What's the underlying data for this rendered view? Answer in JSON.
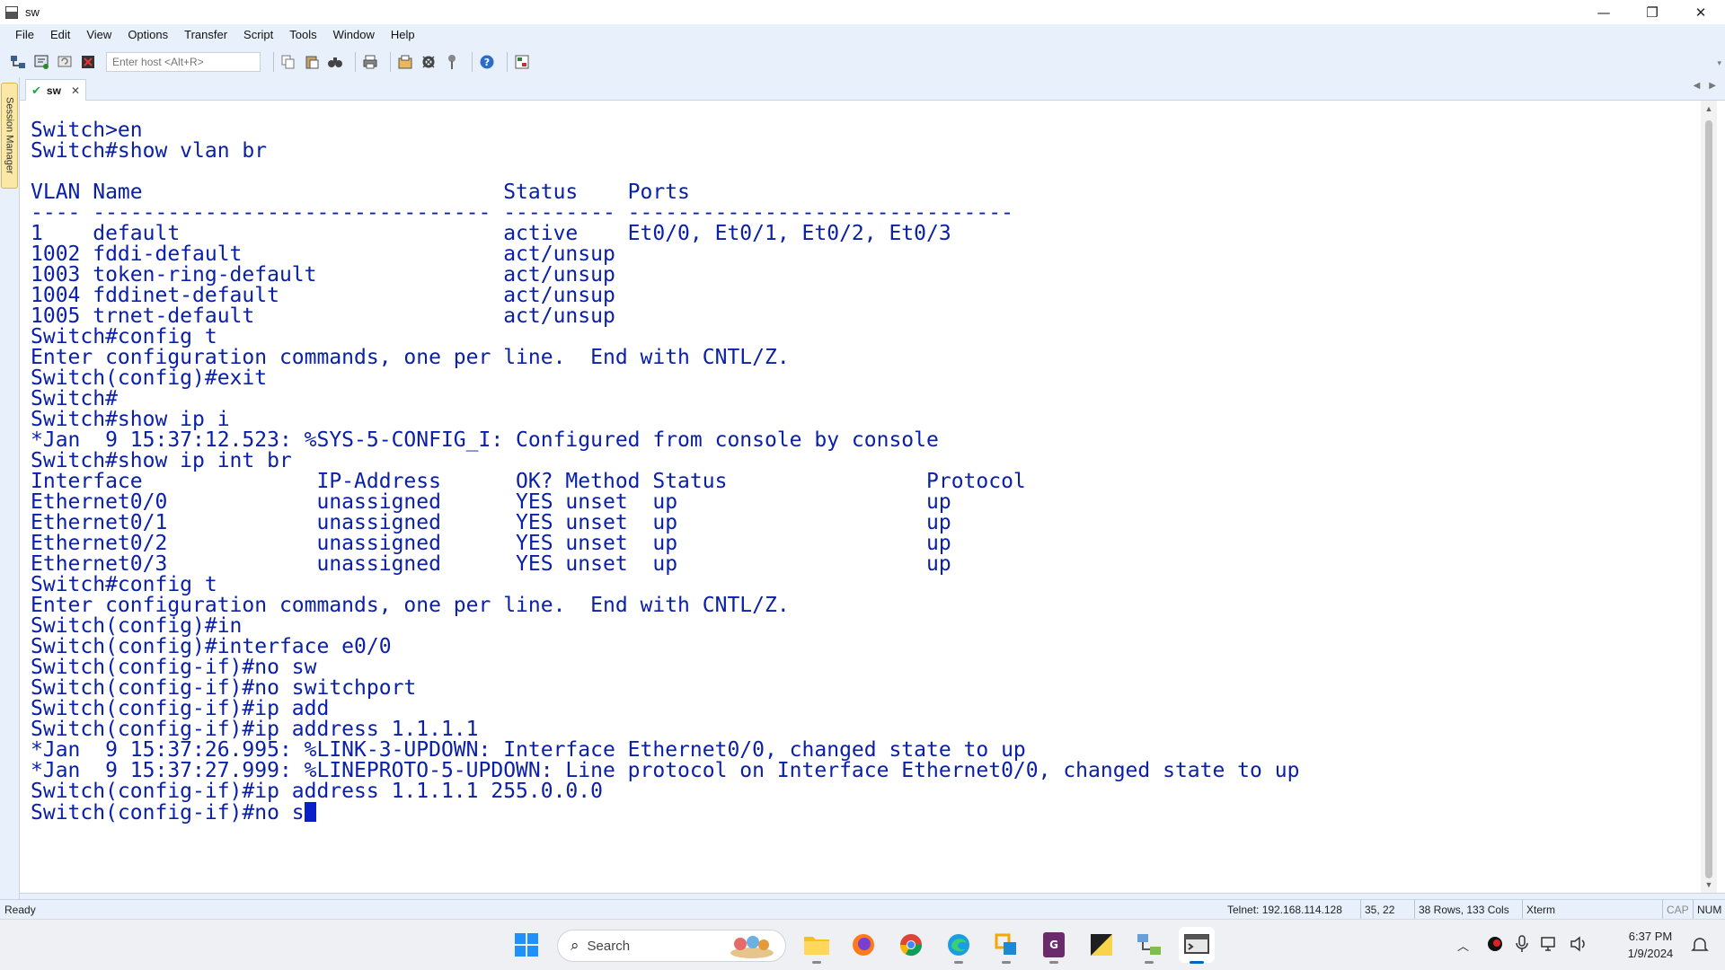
{
  "window": {
    "title": "sw",
    "buttons": {
      "minimize": "—",
      "restore": "❐",
      "close": "✕"
    }
  },
  "menu": [
    "File",
    "Edit",
    "View",
    "Options",
    "Transfer",
    "Script",
    "Tools",
    "Window",
    "Help"
  ],
  "toolbar": {
    "host_placeholder": "Enter host <Alt+R>"
  },
  "tab": {
    "label": "sw"
  },
  "session_manager": {
    "label": "Session Manager"
  },
  "terminal": {
    "lines": [
      "Switch>en",
      "Switch#show vlan br",
      "",
      "VLAN Name                             Status    Ports",
      "---- -------------------------------- --------- -------------------------------",
      "1    default                          active    Et0/0, Et0/1, Et0/2, Et0/3",
      "1002 fddi-default                     act/unsup",
      "1003 token-ring-default               act/unsup",
      "1004 fddinet-default                  act/unsup",
      "1005 trnet-default                    act/unsup",
      "Switch#config t",
      "Enter configuration commands, one per line.  End with CNTL/Z.",
      "Switch(config)#exit",
      "Switch#",
      "Switch#show ip i",
      "*Jan  9 15:37:12.523: %SYS-5-CONFIG_I: Configured from console by console",
      "Switch#show ip int br",
      "Interface              IP-Address      OK? Method Status                Protocol",
      "Ethernet0/0            unassigned      YES unset  up                    up",
      "Ethernet0/1            unassigned      YES unset  up                    up",
      "Ethernet0/2            unassigned      YES unset  up                    up",
      "Ethernet0/3            unassigned      YES unset  up                    up",
      "Switch#config t",
      "Enter configuration commands, one per line.  End with CNTL/Z.",
      "Switch(config)#in",
      "Switch(config)#interface e0/0",
      "Switch(config-if)#no sw",
      "Switch(config-if)#no switchport",
      "Switch(config-if)#ip add",
      "Switch(config-if)#ip address 1.1.1.1",
      "*Jan  9 15:37:26.995: %LINK-3-UPDOWN: Interface Ethernet0/0, changed state to up",
      "*Jan  9 15:37:27.999: %LINEPROTO-5-UPDOWN: Line protocol on Interface Ethernet0/0, changed state to up",
      "Switch(config-if)#ip address 1.1.1.1 255.0.0.0"
    ],
    "prompt_line": "Switch(config-if)#no s"
  },
  "status": {
    "ready": "Ready",
    "connection": "Telnet: 192.168.114.128",
    "cursor_pos": "35, 22",
    "size": "38 Rows, 133 Cols",
    "emulation": "Xterm",
    "cap": "CAP",
    "num": "NUM"
  },
  "taskbar": {
    "search_label": "Search",
    "clock_time": "6:37 PM",
    "clock_date": "1/9/2024"
  },
  "colors": {
    "terminal_text": "#0a20a8",
    "chrome_bg": "#e8f1fb",
    "session_tab": "#fbe8a6"
  }
}
